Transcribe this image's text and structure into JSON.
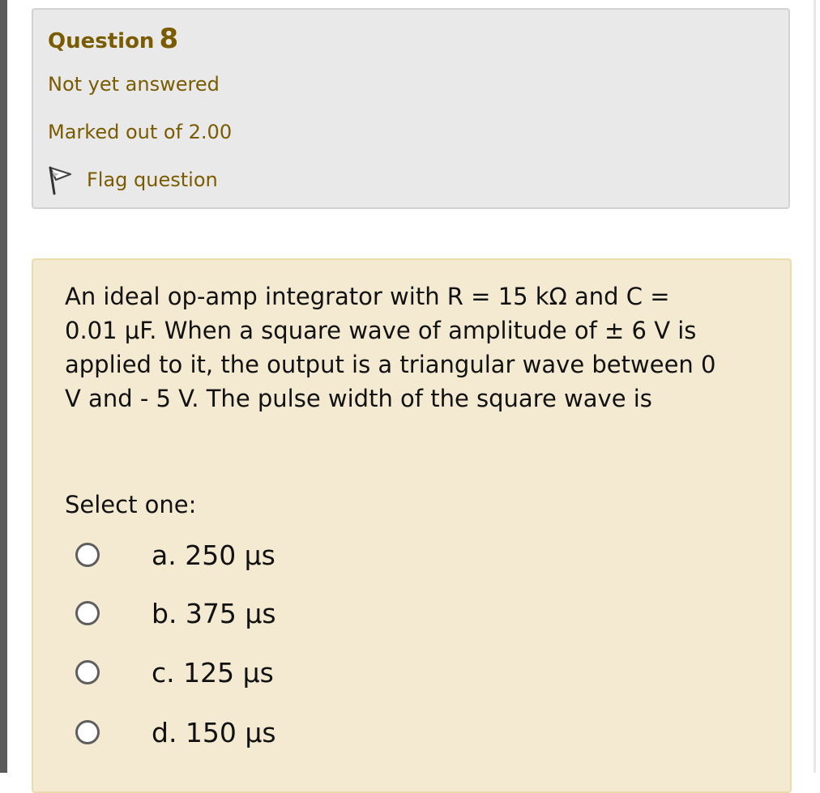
{
  "question_info": {
    "title_word": "Question",
    "number": "8",
    "state": "Not yet answered",
    "grade": "Marked out of 2.00",
    "flag_label": "Flag question",
    "flag_icon": "flag-icon"
  },
  "question": {
    "text": "An ideal op-amp integrator with R = 15 kΩ and C = 0.01 μF. When a square wave of amplitude of ± 6 V is applied to it, the output is a triangular wave between 0 V and - 5 V. The pulse width of the square wave is",
    "prompt": "Select one:",
    "options": [
      {
        "label": "a. 250 μs",
        "selected": false
      },
      {
        "label": "b. 375 μs",
        "selected": false
      },
      {
        "label": "c. 125 μs",
        "selected": false
      },
      {
        "label": "d. 150 μs",
        "selected": false
      }
    ]
  },
  "colors": {
    "info_background": "#e9e9e9",
    "info_text": "#7a5b00",
    "content_background": "#f4ead2",
    "content_border": "#ecdcab"
  }
}
